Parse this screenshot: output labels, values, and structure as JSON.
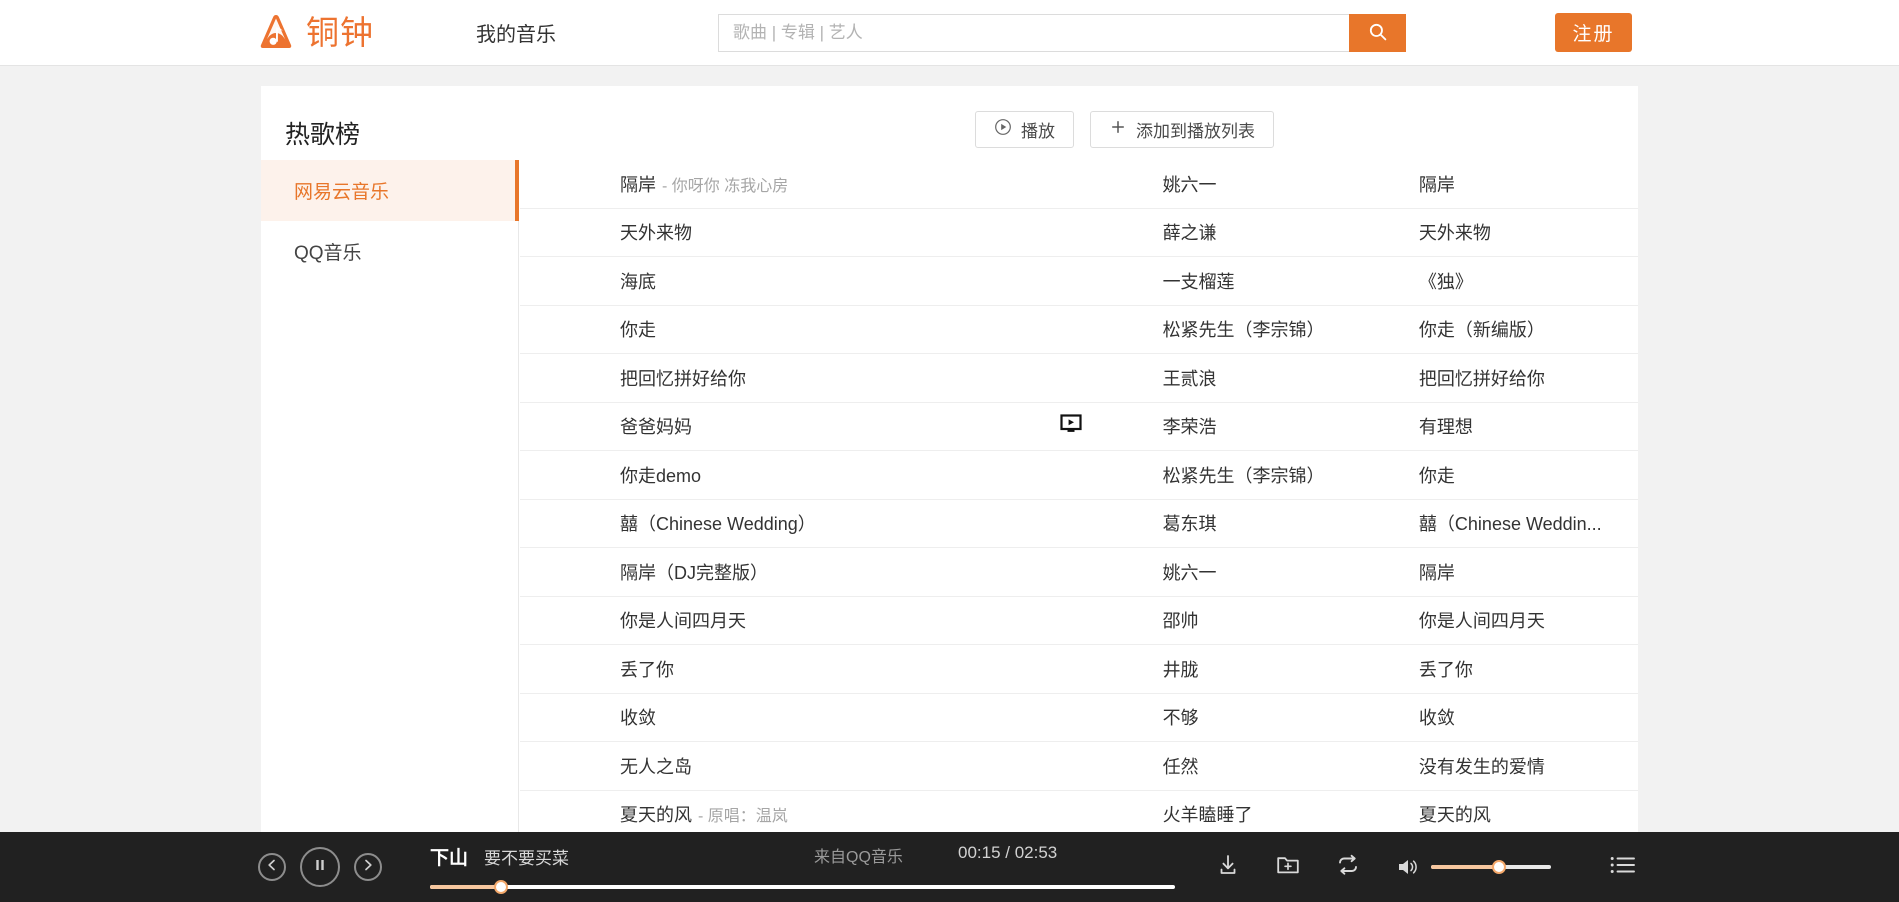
{
  "header": {
    "logo_text": "铜钟",
    "logo_icon": "bell-music-logo-icon",
    "nav_link": "我的音乐",
    "search": {
      "placeholder": "歌曲 | 专辑 | 艺人",
      "value": "",
      "button_icon": "search-icon"
    },
    "register_label": "注册"
  },
  "colors": {
    "accent": "#e8762a",
    "accent_light": "#fdf2eb",
    "player_bg": "#212121",
    "progress_fill": "#f7c79f"
  },
  "main": {
    "title": "热歌榜",
    "play_button": {
      "label": "播放",
      "icon": "play-circle-icon"
    },
    "add_button": {
      "label": "添加到播放列表",
      "icon": "plus-icon"
    }
  },
  "sidebar": {
    "items": [
      {
        "label": "网易云音乐",
        "active": true
      },
      {
        "label": "QQ音乐",
        "active": false
      }
    ]
  },
  "songs": [
    {
      "name": "隔岸",
      "sub": "- 你呀你 冻我心房",
      "mv": false,
      "artist": "姚六一",
      "album": "隔岸"
    },
    {
      "name": "天外来物",
      "sub": "",
      "mv": false,
      "artist": "薛之谦",
      "album": "天外来物"
    },
    {
      "name": "海底",
      "sub": "",
      "mv": false,
      "artist": "一支榴莲",
      "album": "《独》"
    },
    {
      "name": "你走",
      "sub": "",
      "mv": false,
      "artist": "松紧先生（李宗锦）",
      "album": "你走（新编版）"
    },
    {
      "name": "把回忆拼好给你",
      "sub": "",
      "mv": false,
      "artist": "王贰浪",
      "album": "把回忆拼好给你"
    },
    {
      "name": "爸爸妈妈",
      "sub": "",
      "mv": true,
      "artist": "李荣浩",
      "album": "有理想"
    },
    {
      "name": "你走demo",
      "sub": "",
      "mv": false,
      "artist": "松紧先生（李宗锦）",
      "album": "你走"
    },
    {
      "name": "囍（Chinese Wedding）",
      "sub": "",
      "mv": false,
      "artist": "葛东琪",
      "album": "囍（Chinese Weddin..."
    },
    {
      "name": "隔岸（DJ完整版）",
      "sub": "",
      "mv": false,
      "artist": "姚六一",
      "album": "隔岸"
    },
    {
      "name": "你是人间四月天",
      "sub": "",
      "mv": false,
      "artist": "邵帅",
      "album": "你是人间四月天"
    },
    {
      "name": "丢了你",
      "sub": "",
      "mv": false,
      "artist": "井胧",
      "album": "丢了你"
    },
    {
      "name": "收敛",
      "sub": "",
      "mv": false,
      "artist": "不够",
      "album": "收敛"
    },
    {
      "name": "无人之岛",
      "sub": "",
      "mv": false,
      "artist": "任然",
      "album": "没有发生的爱情"
    },
    {
      "name": "夏天的风",
      "sub": "- 原唱：温岚",
      "mv": false,
      "artist": "火羊瞌睡了",
      "album": "夏天的风"
    }
  ],
  "player": {
    "prev_icon": "previous-track-icon",
    "pause_icon": "pause-icon",
    "next_icon": "next-track-icon",
    "track_title": "下山",
    "track_artist": "要不要买菜",
    "source": "来自QQ音乐",
    "time": "00:15 / 02:53",
    "progress_percent": 9.5,
    "tools": [
      {
        "icon": "download-icon"
      },
      {
        "icon": "add-to-folder-icon"
      },
      {
        "icon": "repeat-icon"
      }
    ],
    "volume_icon": "volume-icon",
    "volume_percent": 57,
    "queue_icon": "playlist-queue-icon"
  }
}
